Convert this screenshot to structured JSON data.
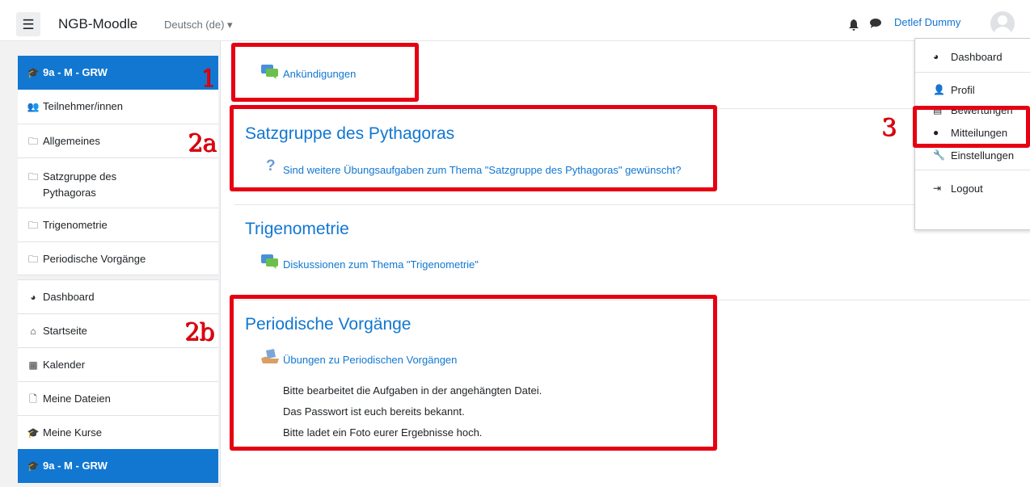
{
  "navbar": {
    "menu_icon": "hamburger-icon",
    "site_name": "NGB-Moodle",
    "language": "Deutsch (de)",
    "language_caret": "▾",
    "user_name": "Detlef Dummy"
  },
  "sidebar": {
    "items": [
      {
        "label": "9a - M - GRW",
        "icon": "graduation-cap-icon",
        "active": true
      },
      {
        "label": "Teilnehmer/innen",
        "icon": "users-icon"
      },
      {
        "label": "Allgemeines",
        "icon": "folder-icon"
      },
      {
        "label": "Satzgruppe des",
        "label2": "Pythagoras",
        "icon": "folder-icon"
      },
      {
        "label": "Trigenometrie",
        "icon": "folder-icon"
      },
      {
        "label": "Periodische Vorgänge",
        "icon": "folder-icon"
      },
      {
        "label": "Dashboard",
        "icon": "dashboard-icon"
      },
      {
        "label": "Startseite",
        "icon": "home-icon"
      },
      {
        "label": "Kalender",
        "icon": "calendar-icon"
      },
      {
        "label": "Meine Dateien",
        "icon": "file-icon"
      },
      {
        "label": "Meine Kurse",
        "icon": "graduation-cap-icon"
      },
      {
        "label": "9a - M - GRW",
        "icon": "graduation-cap-icon",
        "active": true
      }
    ]
  },
  "main": {
    "announcements": "Ankündigungen",
    "sections": [
      {
        "title": "Satzgruppe des Pythagoras",
        "activity": "Sind weitere Übungsaufgaben zum Thema \"Satzgruppe des Pythagoras\" gewünscht?"
      },
      {
        "title": "Trigenometrie",
        "activity": "Diskussionen zum Thema \"Trigenometrie\""
      },
      {
        "title": "Periodische Vorgänge",
        "activity": "Übungen zu Periodischen Vorgängen",
        "lines": [
          "Bitte bearbeitet die Aufgaben in der angehängten Datei.",
          "Das Passwort ist euch bereits bekannt.",
          "Bitte ladet ein Foto eurer Ergebnisse hoch."
        ]
      }
    ]
  },
  "user_menu": {
    "items": [
      "Dashboard",
      "Profil",
      "Bewertungen",
      "Mitteilungen",
      "Einstellungen",
      "Logout"
    ]
  },
  "markers": [
    "1",
    "2a",
    "2b",
    "3"
  ],
  "colors": {
    "accent": "#1177d1",
    "highlight_box": "#e60012"
  }
}
